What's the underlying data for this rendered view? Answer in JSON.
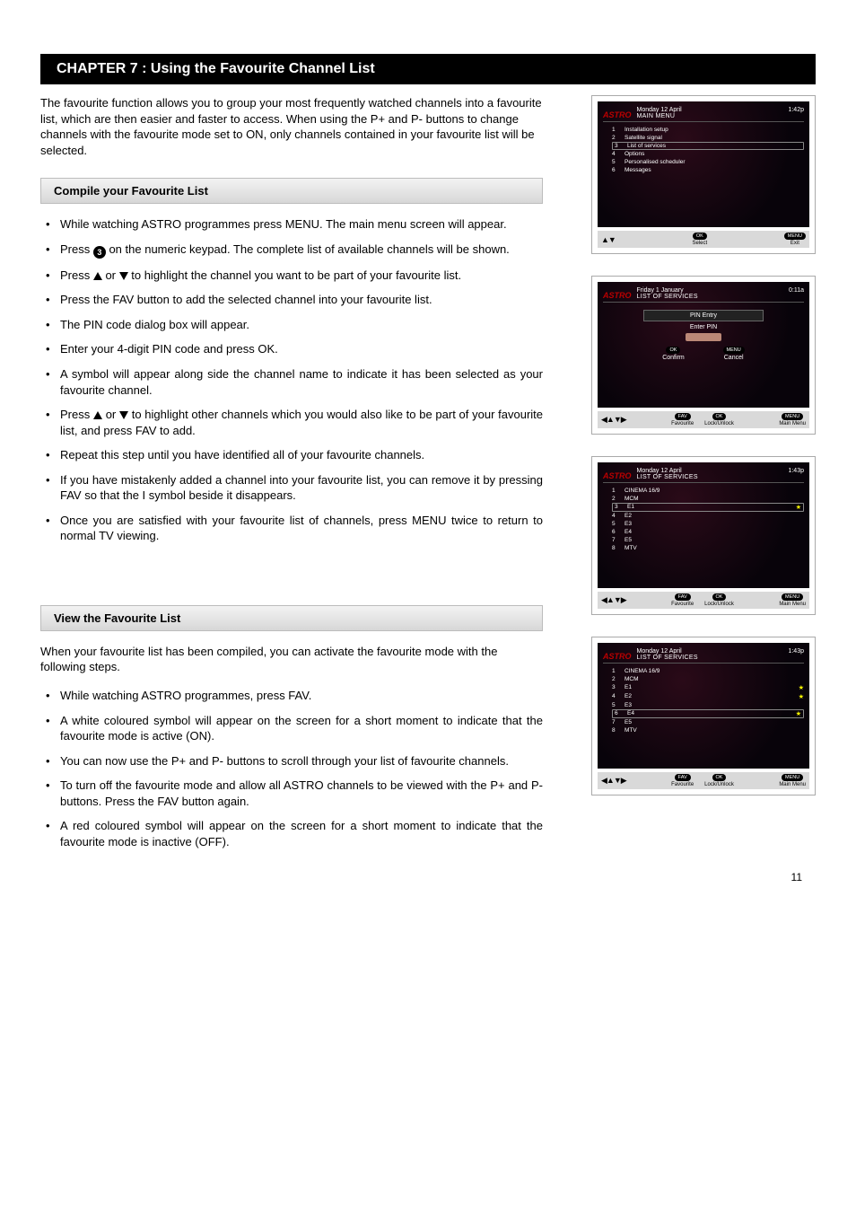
{
  "chapter_title": "CHAPTER 7 : Using the Favourite Channel List",
  "intro": "The favourite function allows you to group your most frequently watched channels into a favourite list, which are then easier and faster to access. When using the P+ and P- buttons to change channels with the favourite mode set to ON, only channels contained in your favourite list will be selected.",
  "section1_title": "Compile your Favourite List",
  "s1": {
    "b1": "While watching ASTRO programmes press MENU. The main menu screen will appear.",
    "b2a": "Press ",
    "b2b": " on the numeric keypad.  The complete list of available channels will be shown.",
    "b3a": "Press ",
    "b3b": " or ",
    "b3c": " to highlight the channel you want to be part of your favourite list.",
    "b4": "Press the FAV button to add the selected channel into your favourite list.",
    "b5": "The PIN code dialog box will appear.",
    "b6": "Enter your 4-digit PIN code and press OK.",
    "b7": "A     symbol will appear along side the channel name to indicate it has been selected as your favourite channel.",
    "b8a": "Press ",
    "b8b": " or ",
    "b8c": " to highlight other channels which you would also like to be part of your favourite list, and press FAV to add.",
    "b9": "Repeat this step until you have identified all of your favourite channels.",
    "b10": "If you have mistakenly added a channel into your favourite list, you can remove it by pressing FAV so that the I symbol beside it disappears.",
    "b11": "Once you are satisfied with your favourite list of channels, press MENU twice to return to normal TV viewing."
  },
  "section2_title": "View the Favourite List",
  "s2_intro": "When your favourite list has been compiled, you can activate the favourite mode with the following steps.",
  "s2": {
    "b1": "While watching ASTRO programmes, press FAV.",
    "b2": "A white coloured     symbol will appear on the screen for a short moment to indicate that the favourite mode is active (ON).",
    "b3": "You can now use the P+ and P- buttons to scroll through your list of favourite channels.",
    "b4": "To turn off the favourite mode and allow all ASTRO channels to be viewed with the P+ and P- buttons. Press the FAV button again.",
    "b5": "A red coloured     symbol will appear on the screen for a short moment to indicate that the favourite mode is inactive (OFF)."
  },
  "shots": {
    "astro": "ASTRO",
    "main": {
      "date": "Monday 12 April",
      "time": "1:42p",
      "title": "MAIN MENU",
      "items": [
        {
          "n": "1",
          "t": "Installation setup"
        },
        {
          "n": "2",
          "t": "Satellite signal"
        },
        {
          "n": "3",
          "t": "List of services"
        },
        {
          "n": "4",
          "t": "Options"
        },
        {
          "n": "5",
          "t": "Personalised scheduler"
        },
        {
          "n": "6",
          "t": "Messages"
        }
      ],
      "sel_index": 2,
      "ok": "OK",
      "ok_l": "Select",
      "menu": "MENU",
      "menu_l": "Exit"
    },
    "pin": {
      "date": "Friday 1 January",
      "time": "0:11a",
      "title": "LIST OF SERVICES",
      "hdr": "PIN Entry",
      "lbl": "Enter PIN",
      "ok": "OK",
      "ok_l": "Confirm",
      "menu": "MENU",
      "menu_l": "Cancel",
      "fav": "FAV",
      "fav_l": "Favourite",
      "okb": "OK",
      "okb_l": "Lock/Unlock",
      "menub": "MENU",
      "menub_l": "Main Menu"
    },
    "list1": {
      "date": "Monday 12 April",
      "time": "1:43p",
      "title": "LIST OF SERVICES",
      "items": [
        {
          "n": "1",
          "t": "CINEMA 16/9"
        },
        {
          "n": "2",
          "t": "MCM"
        },
        {
          "n": "3",
          "t": "E1",
          "star": true,
          "sel": true
        },
        {
          "n": "4",
          "t": "E2"
        },
        {
          "n": "5",
          "t": "E3"
        },
        {
          "n": "6",
          "t": "E4"
        },
        {
          "n": "7",
          "t": "E5"
        },
        {
          "n": "8",
          "t": "MTV"
        }
      ],
      "fav": "FAV",
      "fav_l": "Favourite",
      "ok": "OK",
      "ok_l": "Lock/Unlock",
      "menu": "MENU",
      "menu_l": "Main Menu"
    },
    "list2": {
      "date": "Monday 12 April",
      "time": "1:43p",
      "title": "LIST OF SERVICES",
      "items": [
        {
          "n": "1",
          "t": "CINEMA 16/9"
        },
        {
          "n": "2",
          "t": "MCM"
        },
        {
          "n": "3",
          "t": "E1",
          "star": true
        },
        {
          "n": "4",
          "t": "E2",
          "star": true
        },
        {
          "n": "5",
          "t": "E3"
        },
        {
          "n": "6",
          "t": "E4",
          "star": true,
          "sel": true
        },
        {
          "n": "7",
          "t": "E5"
        },
        {
          "n": "8",
          "t": "MTV"
        }
      ],
      "fav": "FAV",
      "fav_l": "Favourite",
      "ok": "OK",
      "ok_l": "Lock/Unlock",
      "menu": "MENU",
      "menu_l": "Main Menu"
    }
  },
  "page_number": "11"
}
